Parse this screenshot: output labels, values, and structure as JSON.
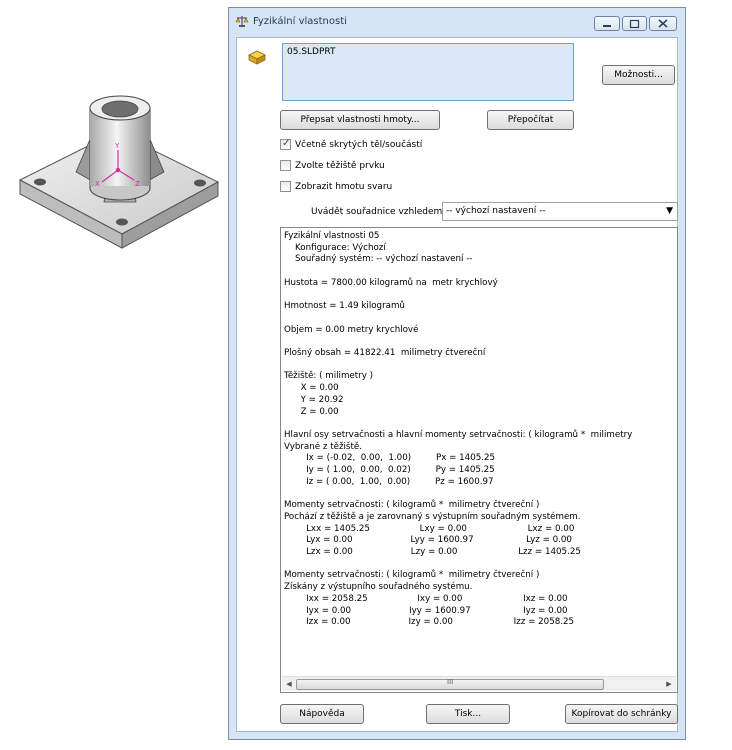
{
  "window": {
    "title": "Fyzikální vlastnosti"
  },
  "selection": {
    "item": "05.SLDPRT"
  },
  "buttons": {
    "options": "Možnosti...",
    "override_mass": "Přepsat vlastnosti hmoty...",
    "recalculate": "Přepočítat",
    "help": "Nápověda",
    "print": "Tisk...",
    "copy": "Kopírovat do schránky"
  },
  "checkboxes": [
    {
      "label": "Včetně skrytých těl/součástí",
      "checked": true
    },
    {
      "label": "Zvolte těžiště prvku",
      "checked": false
    },
    {
      "label": "Zobrazit hmotu svaru",
      "checked": false
    }
  ],
  "coordinates": {
    "label": "Uvádět souřadnice vzhledem k:",
    "selected": "-- výchozí nastavení --"
  },
  "results": {
    "lines": [
      "Fyzikální vlastnosti 05",
      "    Konfigurace: Výchozí",
      "    Souřadný systém: -- výchozí nastavení --",
      "",
      "Hustota = 7800.00 kilogramů na  metr krychlový",
      "",
      "Hmotnost = 1.49 kilogramů",
      "",
      "Objem = 0.00 metry krychlové",
      "",
      "Plošný obsah = 41822.41  milimetry čtvereční",
      "",
      "Těžiště: ( milimetry )",
      "      X = 0.00",
      "      Y = 20.92",
      "      Z = 0.00",
      "",
      "Hlavní osy setrvačnosti a hlavní momenty setrvačnosti: ( kilogramů *  milimetry",
      "Vybrané z těžiště.",
      "        Ix = (-0.02,  0.00,  1.00)         Px = 1405.25",
      "        Iy = ( 1.00,  0.00,  0.02)         Py = 1405.25",
      "        Iz = ( 0.00,  1.00,  0.00)         Pz = 1600.97",
      "",
      "Momenty setrvačnosti: ( kilogramů *  milimetry čtvereční )",
      "Pochází z těžiště a je zarovnaný s výstupním souřadným systémem.",
      "        Lxx = 1405.25                  Lxy = 0.00                      Lxz = 0.00",
      "        Lyx = 0.00                     Lyy = 1600.97                   Lyz = 0.00",
      "        Lzx = 0.00                     Lzy = 0.00                      Lzz = 1405.25",
      "",
      "Momenty setrvačnosti: ( kilogramů *  milimetry čtvereční )",
      "Získány z výstupního souřadného systému.",
      "        Ixx = 2058.25                  Ixy = 0.00                      Ixz = 0.00",
      "        Iyx = 0.00                     Iyy = 1600.97                   Iyz = 0.00",
      "        Izx = 0.00                     Izy = 0.00                      Izz = 2058.25"
    ]
  },
  "scrollbar": {
    "grip": "III"
  },
  "part_axes": {
    "x": "X",
    "y": "Y",
    "z": "Z"
  },
  "colors": {
    "window_frame": "#d6e5f5",
    "selection_box": "#dbe8f7",
    "part_body": "#e4e4e4"
  },
  "icons": {
    "window_icon": "mass-properties-scale-icon",
    "part_icon": "part-component-icon"
  }
}
